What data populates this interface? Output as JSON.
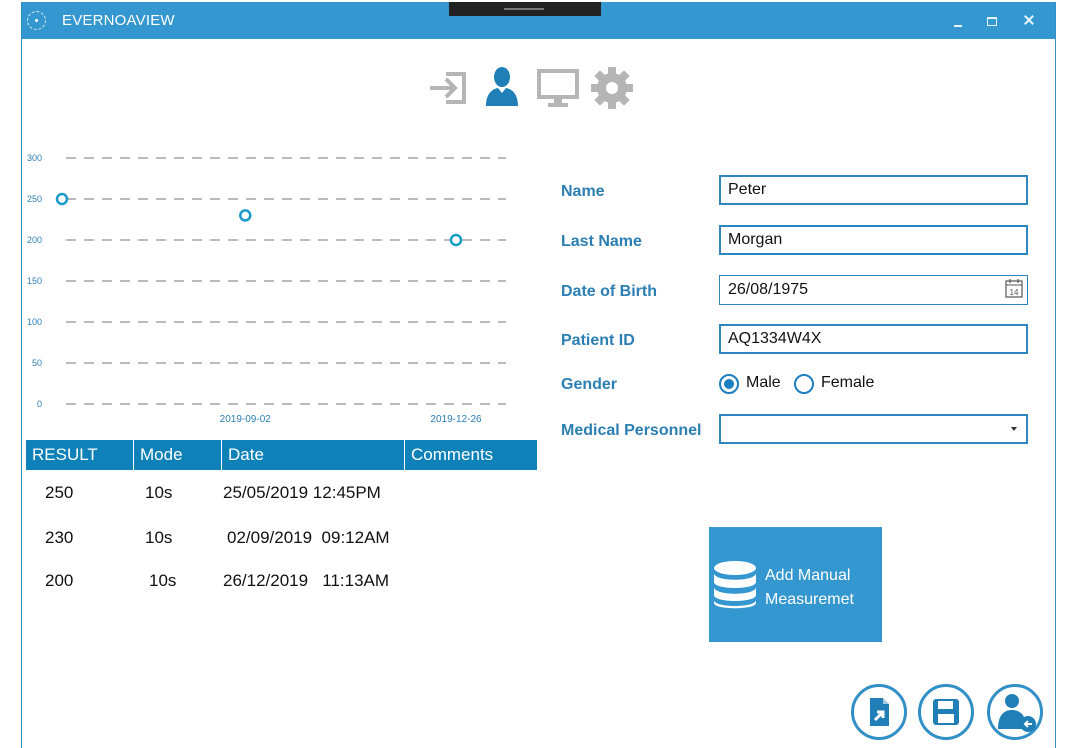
{
  "window": {
    "title": "EVERNOAVIEW"
  },
  "chart_data": {
    "type": "scatter",
    "ylim": [
      0,
      300
    ],
    "yticks": [
      "300",
      "250",
      "200",
      "150",
      "100",
      "50",
      "0"
    ],
    "xtick_labels": [
      "2019-09-02",
      "2019-12-26"
    ],
    "points": [
      {
        "x": "2019-05-25",
        "y": 250
      },
      {
        "x": "2019-09-02",
        "y": 230
      },
      {
        "x": "2019-12-26",
        "y": 200
      }
    ],
    "grid": true,
    "colors": {
      "marker": "#1a9bc9",
      "grid": "#777777",
      "tick": "#2c7fb3"
    }
  },
  "table": {
    "columns": [
      "RESULT",
      "Mode",
      "Date",
      "Comments"
    ],
    "rows": [
      {
        "result": "250",
        "mode": "10s",
        "date": "25/05/2019 12:45PM",
        "comments": ""
      },
      {
        "result": "230",
        "mode": "10s",
        "date": "02/09/2019  09:12AM",
        "comments": ""
      },
      {
        "result": "200",
        "mode": "10s",
        "date": "26/12/2019   11:13AM",
        "comments": ""
      }
    ]
  },
  "form": {
    "name_label": "Name",
    "name_value": "Peter",
    "last_name_label": "Last Name",
    "last_name_value": "Morgan",
    "dob_label": "Date of Birth",
    "dob_value": "26/08/1975",
    "calendar_day": "14",
    "patient_id_label": "Patient ID",
    "patient_id_value": "AQ1334W4X",
    "gender_label": "Gender",
    "gender_options": [
      "Male",
      "Female"
    ],
    "gender_selected": "Male",
    "personnel_label": "Medical Personnel",
    "personnel_value": ""
  },
  "actions": {
    "add_line1": "Add Manual",
    "add_line2": "Measuremet"
  },
  "icons": {
    "nav": [
      "login-icon",
      "user-icon",
      "monitor-icon",
      "gear-icon"
    ],
    "bottom": [
      "export-file-icon",
      "save-icon",
      "user-return-icon"
    ]
  },
  "colors": {
    "accent": "#3597cf",
    "nav_active": "#1f7fb6",
    "nav_inactive": "#b5b5b5"
  }
}
